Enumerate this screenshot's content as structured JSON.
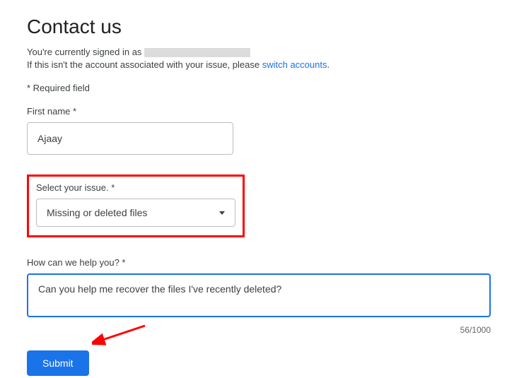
{
  "title": "Contact us",
  "signedInPrefix": "You're currently signed in as",
  "switchLinePrefix": "If this isn't the account associated with your issue, please ",
  "switchLinkText": "switch accounts",
  "switchLineSuffix": ".",
  "requiredNote": "* Required field",
  "firstName": {
    "label": "First name *",
    "value": "Ajaay"
  },
  "issue": {
    "label": "Select your issue. *",
    "selected": "Missing or deleted files"
  },
  "help": {
    "label": "How can we help you? *",
    "value": "Can you help me recover the files I've recently deleted?",
    "counter": "56/1000"
  },
  "submitLabel": "Submit"
}
